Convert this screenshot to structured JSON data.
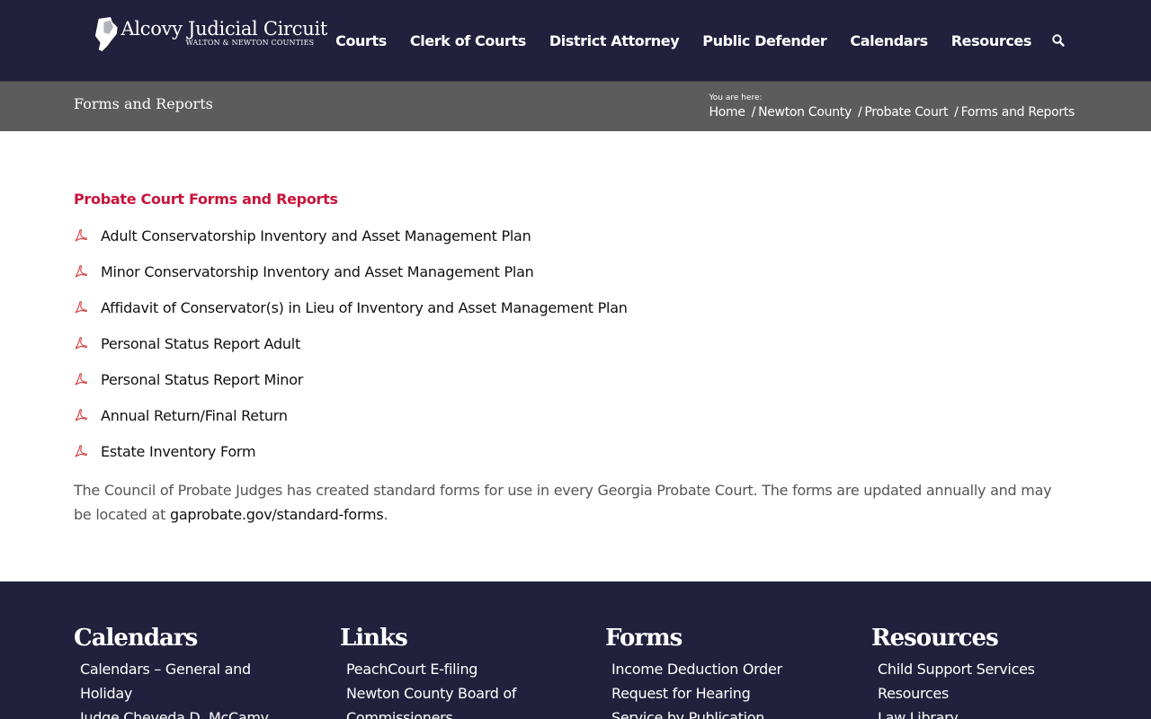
{
  "header": {
    "logo_title": "Alcovy Judicial Circuit",
    "logo_subtitle": "WALTON & NEWTON COUNTIES",
    "nav": [
      "Courts",
      "Clerk of Courts",
      "District Attorney",
      "Public Defender",
      "Calendars",
      "Resources"
    ],
    "search_icon": "search-icon"
  },
  "titlebar": {
    "title": "Forms and Reports",
    "you_are_here": "You are here:",
    "breadcrumb": [
      "Home",
      "Newton County",
      "Probate Court",
      "Forms and Reports"
    ],
    "separator": "/"
  },
  "main": {
    "section_title": "Probate Court Forms and Reports",
    "forms": [
      "Adult Conservatorship Inventory and Asset Management Plan",
      "Minor Conservatorship Inventory and Asset Management Plan",
      "Affidavit of Conservator(s) in Lieu of Inventory and Asset Management Plan",
      "Personal Status Report Adult",
      "Personal Status Report Minor",
      "Annual Return/Final Return",
      "Estate Inventory Form"
    ],
    "note_text": "The Council of Probate Judges has created standard forms for use in every Georgia Probate Court. The forms are updated annually and may be located at ",
    "note_link": "gaprobate.gov/standard-forms",
    "note_end": "."
  },
  "footer": {
    "columns": [
      {
        "heading": "Calendars",
        "items": [
          "Calendars – General and Holiday",
          "Judge Cheveda D. McCamy"
        ]
      },
      {
        "heading": "Links",
        "items": [
          "PeachCourt E-filing",
          "Newton County Board of Commissioners"
        ]
      },
      {
        "heading": "Forms",
        "items": [
          "Income Deduction Order",
          "Request for Hearing",
          "Service by Publication Forms"
        ]
      },
      {
        "heading": "Resources",
        "items": [
          "Child Support Services",
          "Resources",
          "Law Library"
        ]
      }
    ]
  },
  "colors": {
    "header_bg": "#21213d",
    "titlebar_bg": "#5c5c5c",
    "accent": "#c8143c"
  }
}
